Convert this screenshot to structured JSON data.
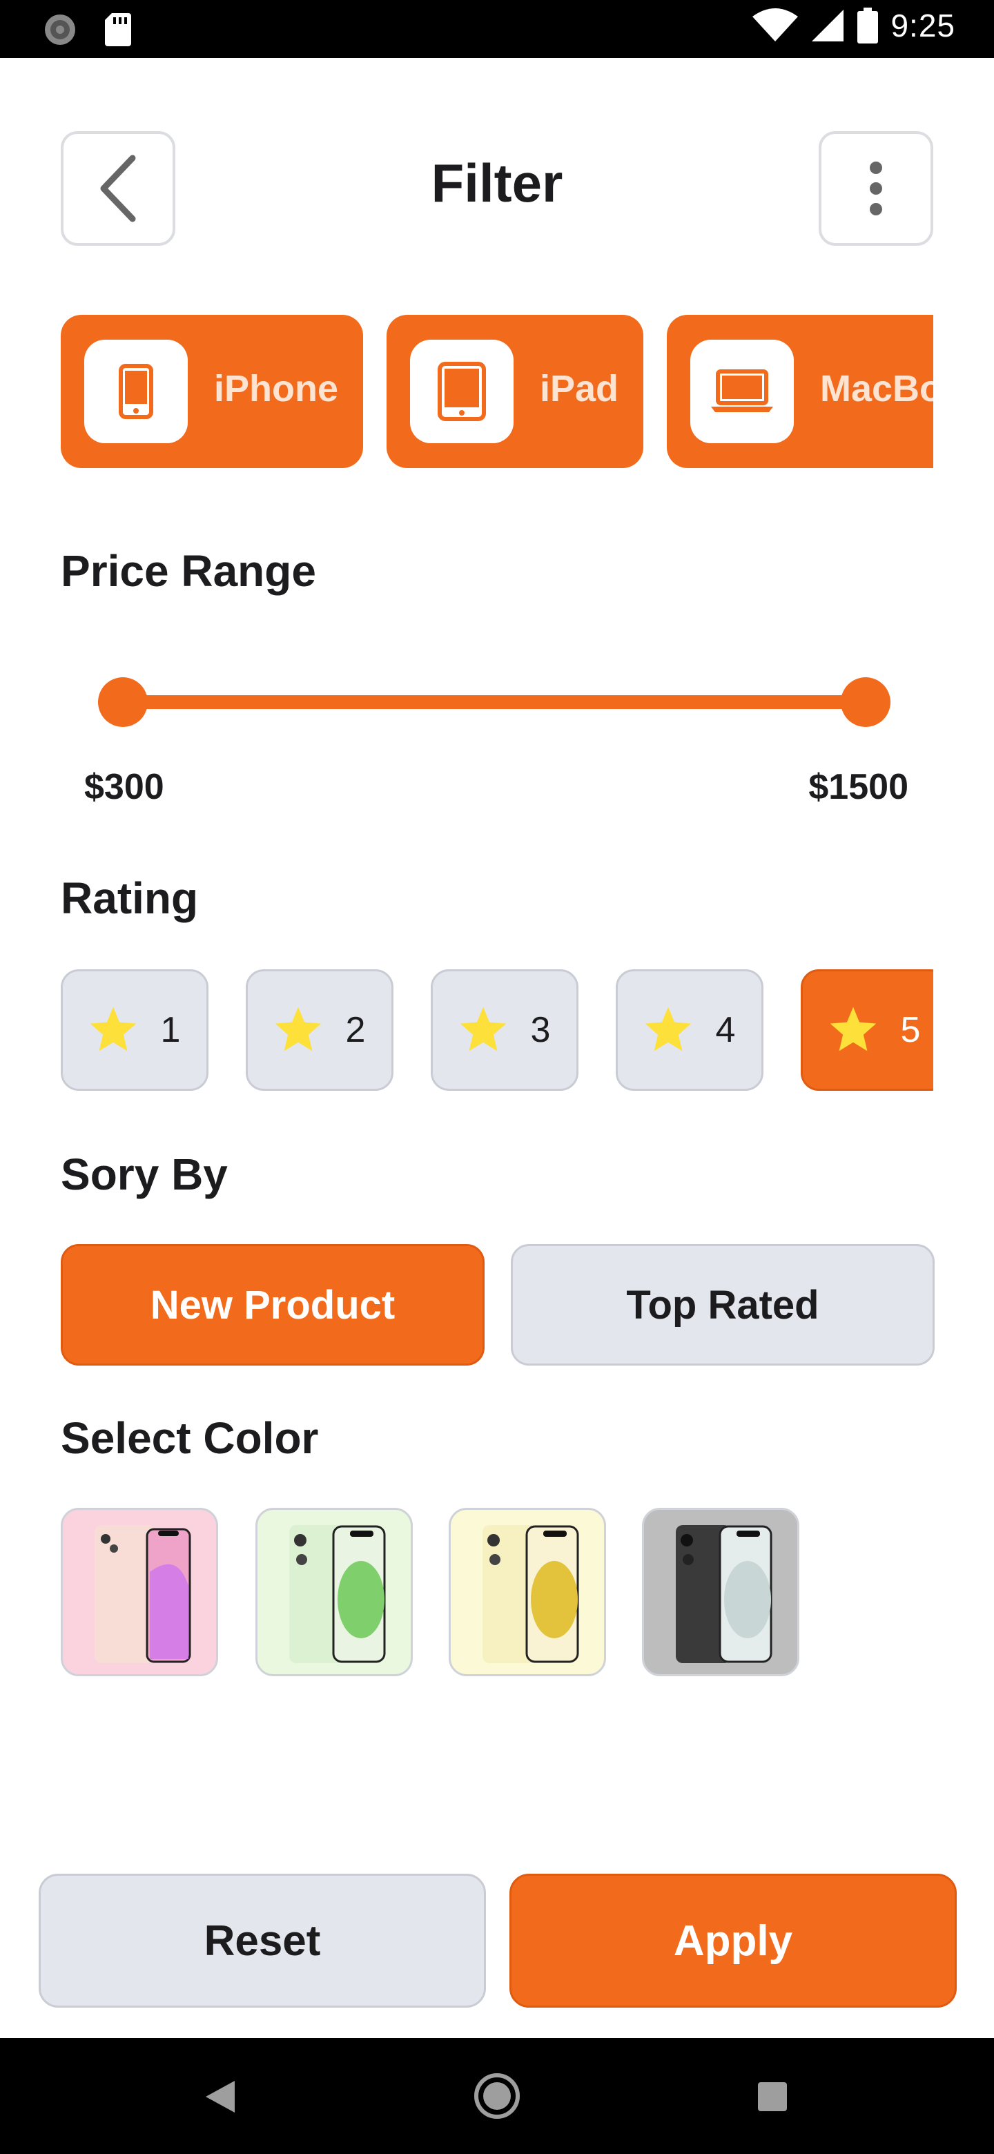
{
  "status_bar": {
    "time": "9:25",
    "icons": [
      "settings-gear-icon",
      "sd-card-icon",
      "wifi-icon",
      "cellular-signal-icon",
      "battery-icon"
    ]
  },
  "header": {
    "title": "Filter",
    "back_icon": "chevron-left-icon",
    "more_icon": "more-vertical-icon"
  },
  "categories": [
    {
      "label": "iPhone",
      "icon": "smartphone-icon"
    },
    {
      "label": "iPad",
      "icon": "tablet-icon"
    },
    {
      "label": "MacBook",
      "icon": "laptop-icon"
    }
  ],
  "price_range": {
    "title": "Price Range",
    "min_label": "$300",
    "max_label": "$1500"
  },
  "rating": {
    "title": "Rating",
    "options": [
      "1",
      "2",
      "3",
      "4",
      "5"
    ],
    "selected": "5",
    "icon": "star-icon"
  },
  "sort_by": {
    "title": "Sory By",
    "options": [
      "New Product",
      "Top Rated"
    ],
    "selected": "New Product"
  },
  "select_color": {
    "title": "Select Color",
    "swatches": [
      {
        "name": "pink",
        "bg": "#fbd3df",
        "phone": "#f8dcd6",
        "accent": "#f0a3c9"
      },
      {
        "name": "green",
        "bg": "#eaf8e0",
        "phone": "#dbf1d2",
        "accent": "#7fcf6c"
      },
      {
        "name": "yellow",
        "bg": "#fcf9d6",
        "phone": "#f7f0c0",
        "accent": "#e2c33b"
      },
      {
        "name": "black",
        "bg": "#bdbdbd",
        "phone": "#3a3a3a",
        "accent": "#c8d6d6"
      }
    ]
  },
  "footer": {
    "reset_label": "Reset",
    "apply_label": "Apply"
  },
  "colors": {
    "accent": "#f26b1d",
    "chip_gray": "#e3e6ec",
    "star": "#fde03a"
  }
}
